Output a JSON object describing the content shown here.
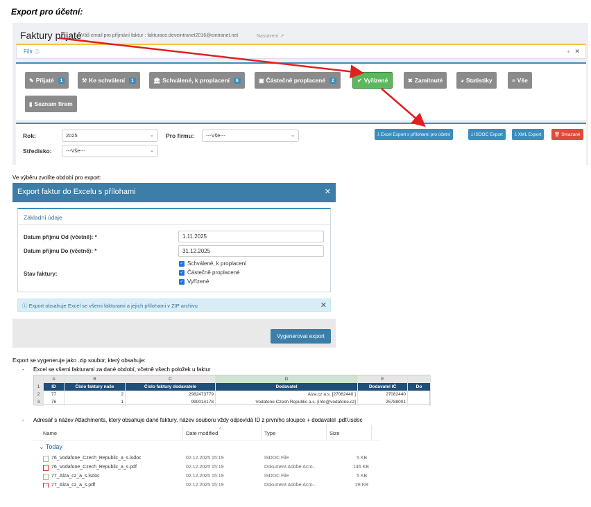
{
  "doc_title": "Export pro účetní:",
  "app": {
    "page_title": "Faktury přijaté",
    "email_info": "Váš email pro příjmání faktur : fakturace.deveintranet2016@eintranet.net",
    "settings": "Nastavení",
    "filter_label": "Filtr",
    "status_buttons": [
      {
        "label": "Přijaté",
        "count": "1"
      },
      {
        "label": "Ke schválení",
        "count": "1"
      },
      {
        "label": "Schválené, k proplacení",
        "count": "6"
      },
      {
        "label": "Částečně proplacené",
        "count": "2"
      },
      {
        "label": "Vyřízené"
      },
      {
        "label": "Zamítnuté"
      },
      {
        "label": "Statistiky"
      },
      {
        "label": "Vše"
      },
      {
        "label": "Seznam firem"
      }
    ],
    "filters": {
      "rok_label": "Rok:",
      "rok_value": "2025",
      "firma_label": "Pro firmu:",
      "firma_value": "---Vše---",
      "stredisko_label": "Středisko:",
      "stredisko_value": "---Vše---"
    },
    "export_buttons": {
      "excel": "Excel Export s přílohami pro účetní",
      "isdoc": "ISDOC Export",
      "xml": "XML Export",
      "deleted": "Smazané"
    },
    "colors": {
      "excel": "#3c8dbc",
      "isdoc": "#3c8dbc",
      "xml": "#3c8dbc",
      "deleted": "#dd4b39",
      "active": "#5cb85c"
    }
  },
  "text1": "Ve výběru zvolíte období pro export:",
  "modal": {
    "title": "Export faktur do Excelu s přílohami",
    "section": "Základní údaje",
    "from_label": "Datum příjmu Od (včetně): *",
    "from_value": "1.11.2025",
    "to_label": "Datum příjmu Do (včetně): *",
    "to_value": "31.12.2025",
    "state_label": "Stav faktury:",
    "states": [
      "Schválené, k proplacení",
      "Částečně proplacené",
      "Vyřízené"
    ],
    "info": "Export obsahuje Excel se všemi fakturami a jejich přílohami v ZIP archivu",
    "generate": "Vygenerovat export"
  },
  "text2": "Export se vygeneruje jako .zip soubor, který obsahuje:",
  "bullet1": "Excel se všemi fakturami za dané období, včetně všech položek u faktur",
  "excel": {
    "col_letters": [
      "",
      "A",
      "B",
      "C",
      "D",
      "E",
      ""
    ],
    "headers": [
      "",
      "ID",
      "Číslo faktury naše",
      "Číslo faktury dodavatele",
      "Dodavatel",
      "Dodavatel IČ",
      "Do"
    ],
    "rows": [
      [
        "2",
        "77",
        "2",
        "2982473779",
        "Alza.cz a.s. [27082440 ]",
        "27082440",
        ""
      ],
      [
        "3",
        "76",
        "1",
        "990014178",
        "Vodafone Czech Republic a.s. [info@vodafone.cz]",
        "25788001",
        ""
      ]
    ]
  },
  "bullet2": "Adresář s název Attachments, který obsahuje dané faktury, název souboru vždy odpovídá ID z prvního sloupce + dodavatel .pdf/.isdoc",
  "explorer": {
    "columns": [
      "Name",
      "Date modified",
      "Type",
      "Size"
    ],
    "group": "Today",
    "files": [
      {
        "name": "76_Vodafone_Czech_Republic_a_s.isdoc",
        "date": "02.12.2025 15:19",
        "type": "ISDOC File",
        "size": "5 KB",
        "kind": "isdoc"
      },
      {
        "name": "76_Vodafone_Czech_Republic_a_s.pdf",
        "date": "02.12.2025 15:19",
        "type": "Dokument Adobe Acro...",
        "size": "146 KB",
        "kind": "pdf"
      },
      {
        "name": "77_Alza_cz_a_s.isdoc",
        "date": "02.12.2025 15:19",
        "type": "ISDOC File",
        "size": "5 KB",
        "kind": "isdoc"
      },
      {
        "name": "77_Alza_cz_a_s.pdf",
        "date": "02.12.2025 15:19",
        "type": "Dokument Adobe Acro...",
        "size": "28 KB",
        "kind": "pdf"
      }
    ]
  }
}
